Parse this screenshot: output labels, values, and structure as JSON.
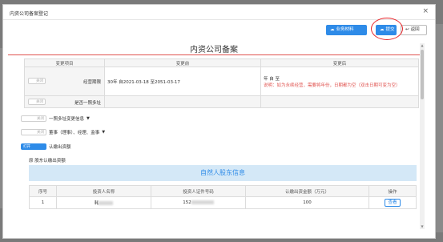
{
  "dialog": {
    "title": "内资公司备案登记",
    "close": "×"
  },
  "toolbar": {
    "materials_label": "业务材料",
    "submit_label": "提交",
    "back_label": "返回"
  },
  "main_title": "内资公司备案",
  "record_table": {
    "headers": [
      "变更项目",
      "变更前",
      "变更后"
    ],
    "rows": [
      {
        "toggle": "关闭",
        "item": "经营期限",
        "before": "30年  自2021-03-18 至2051-03-17",
        "after_line1": "年  自   至",
        "after_note": "说明：如为永续经营，需要将年份，日期都为空（双击日期可变为空）"
      },
      {
        "toggle": "关闭",
        "item": "是否一照多址",
        "before": "",
        "after_line1": "",
        "after_note": ""
      }
    ]
  },
  "extra_rows": [
    {
      "toggle": "关闭",
      "label": "一照多址变更信息"
    },
    {
      "toggle": "关闭",
      "label": "董事（理事）、经理、监事"
    },
    {
      "toggle": "打开",
      "label": "认缴出资额"
    }
  ],
  "original_shareholder_label": "原 股东认缴出资额",
  "natural_person_title": "自然人股东信息",
  "holders_table": {
    "headers": [
      "序号",
      "投资人名称",
      "投资人证件号码",
      "认缴出资金额（万元）",
      "操作"
    ],
    "rows": [
      {
        "index": "1",
        "name_prefix": "耗",
        "id_prefix": "152",
        "amount": "100",
        "action": "查看"
      }
    ]
  },
  "colors": {
    "accent": "#2e8be8",
    "highlight_circle": "#e8262b",
    "red_text": "#e0534f"
  }
}
